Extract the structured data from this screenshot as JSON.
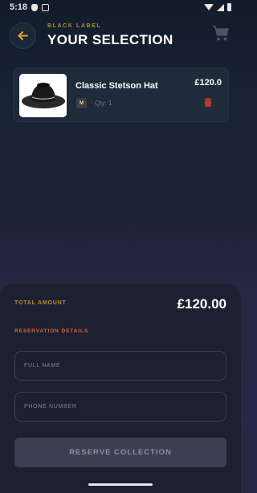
{
  "status_bar": {
    "time": "5:18"
  },
  "header": {
    "subtitle": "BLACK LABEL",
    "title": "YOUR SELECTION",
    "back_icon": "arrow-left-icon",
    "cart_icon": "cart-icon"
  },
  "cart_items": [
    {
      "name": "Classic Stetson Hat",
      "size": "M",
      "qty_label": "Qty: 1",
      "price": "£120.0",
      "image": "stetson-hat",
      "remove_icon": "trash-icon"
    }
  ],
  "summary": {
    "total_label": "TOTAL AMOUNT",
    "total_value": "£120.00",
    "section_label": "RESERVATION DETAILS"
  },
  "form": {
    "full_name": {
      "placeholder": "FULL NAME",
      "value": ""
    },
    "phone": {
      "placeholder": "PHONE NUMBER",
      "value": ""
    },
    "submit_label": "RESERVE COLLECTION"
  },
  "colors": {
    "accent": "#b98a32",
    "section_accent": "#e0652e",
    "delete": "#c0392b",
    "button_disabled": "#3a3f52"
  }
}
